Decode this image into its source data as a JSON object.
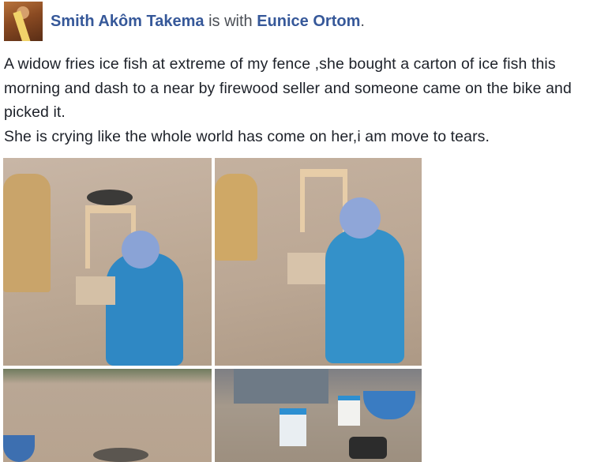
{
  "header": {
    "author": "Smith Akôm Takema",
    "connector": "is with",
    "tagged": "Eunice Ortom",
    "end": "."
  },
  "post": {
    "paragraph1": "A widow fries ice fish at extreme of my fence ,she bought a carton of ice fish this morning and dash to a near by firewood seller and someone came on the bike and picked it.",
    "paragraph2": "She is crying like the whole world has come on her,i am move to tears."
  },
  "colors": {
    "link": "#365899",
    "text": "#1d2129",
    "muted": "#4b4f56"
  }
}
